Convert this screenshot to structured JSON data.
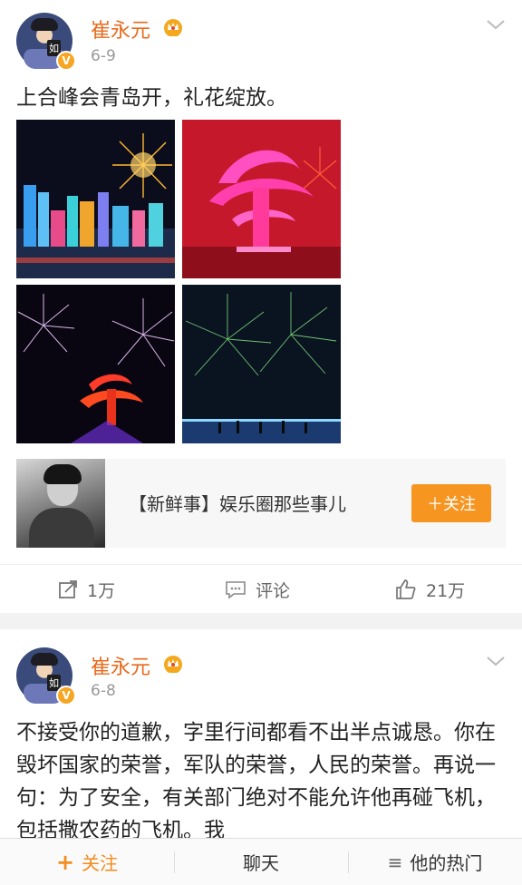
{
  "post1": {
    "username": "崔永元",
    "date": "6-9",
    "text": "上合峰会青岛开，礼花绽放。",
    "topic": {
      "text": "【新鲜事】娱乐圈那些事儿",
      "follow_label": "＋关注"
    },
    "actions": {
      "repost": "1万",
      "comment": "评论",
      "like": "21万"
    }
  },
  "post2": {
    "username": "崔永元",
    "date": "6-8",
    "text": "不接受你的道歉，字里行间都看不出半点诚恳。你在毁坏国家的荣誉，军队的荣誉，人民的荣誉。再说一句：为了安全，有关部门绝对不能允许他再碰飞机，包括撒农药的飞机。我"
  },
  "avatar_tag": "如",
  "verified_badge": "V",
  "bottom_bar": {
    "follow": "关注",
    "chat": "聊天",
    "hot": "他的热门",
    "follow_plus": "+",
    "menu_icon": "≡"
  },
  "colors": {
    "username": "#e96a1c",
    "follow_button": "#f79521",
    "verified": "#f6a623"
  }
}
